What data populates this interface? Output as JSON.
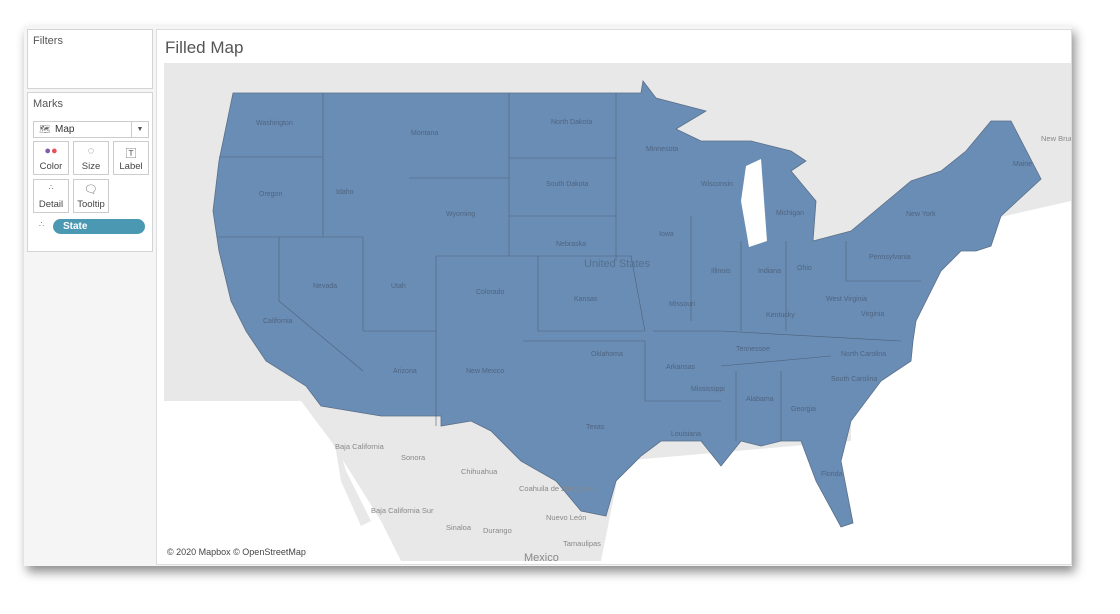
{
  "filters": {
    "title": "Filters"
  },
  "marks": {
    "title": "Marks",
    "mark_type": "Map",
    "buttons": [
      {
        "label": "Color",
        "icon": "color-dots-icon"
      },
      {
        "label": "Size",
        "icon": "size-icon"
      },
      {
        "label": "Label",
        "icon": "label-icon"
      },
      {
        "label": "Detail",
        "icon": "detail-icon"
      },
      {
        "label": "Tooltip",
        "icon": "tooltip-icon"
      }
    ],
    "field": "State"
  },
  "view": {
    "title": "Filled Map",
    "credit": "© 2020 Mapbox © OpenStreetMap",
    "fill_color": "#6a8db5",
    "country_label": "United States",
    "states": [
      "Washington",
      "Oregon",
      "California",
      "Idaho",
      "Nevada",
      "Montana",
      "Wyoming",
      "Utah",
      "Arizona",
      "Colorado",
      "New Mexico",
      "North Dakota",
      "South Dakota",
      "Nebraska",
      "Kansas",
      "Oklahoma",
      "Texas",
      "Minnesota",
      "Iowa",
      "Missouri",
      "Arkansas",
      "Louisiana",
      "Wisconsin",
      "Illinois",
      "Michigan",
      "Indiana",
      "Ohio",
      "Kentucky",
      "Tennessee",
      "Mississippi",
      "Alabama",
      "Georgia",
      "Florida",
      "South Carolina",
      "North Carolina",
      "Virginia",
      "West Virginia",
      "Pennsylvania",
      "New York",
      "Maine"
    ],
    "places": [
      "New Brunswick",
      "Baja California",
      "Sonora",
      "Chihuahua",
      "Coahuila de Zaragoza",
      "Baja California Sur",
      "Sinaloa",
      "Durango",
      "Nuevo León",
      "Tamaulipas",
      "Mexico"
    ]
  }
}
